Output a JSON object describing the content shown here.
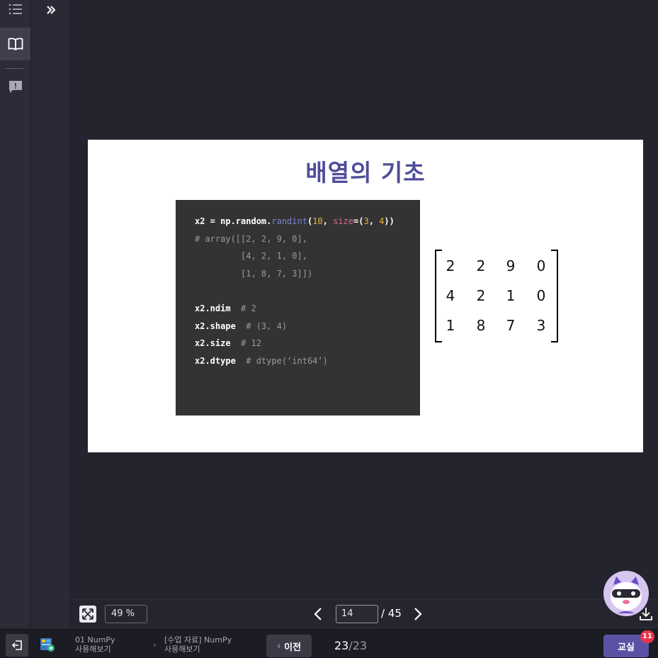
{
  "slide": {
    "title": "배열의 기초",
    "code": {
      "line1": {
        "a": "x2 = np.random.",
        "fn": "randint",
        "b": "(",
        "n1": "10",
        "c": ", ",
        "kw": "size",
        "d": "=(",
        "n2": "3",
        "e": ", ",
        "n3": "4",
        "f": "))"
      },
      "line2": "# array([[2, 2, 9, 0],",
      "line3": "         [4, 2, 1, 0],",
      "line4": "         [1, 8, 7, 3]])",
      "line6": {
        "code": "x2.ndim",
        "comment": "  # 2"
      },
      "line7": {
        "code": "x2.shape",
        "comment": "  # (3, 4)"
      },
      "line8": {
        "code": "x2.size",
        "comment": "  # 12"
      },
      "line9": {
        "code": "x2.dtype",
        "comment": "  # dtype(‘int64’)"
      }
    },
    "matrix": [
      [
        "2",
        "2",
        "9",
        "0"
      ],
      [
        "4",
        "2",
        "1",
        "0"
      ],
      [
        "1",
        "8",
        "7",
        "3"
      ]
    ]
  },
  "viewer": {
    "zoom": "49 %",
    "page_current": "14",
    "page_total": "/ 45"
  },
  "bottom": {
    "breadcrumb1_line1": "01 NumPy",
    "breadcrumb1_line2": "사용해보기",
    "breadcrumb_sep": "›",
    "breadcrumb2_line1": "[수업 자료] NumPy",
    "breadcrumb2_line2": "사용해보기",
    "prev_label": "이전",
    "prev_chevron": "‹",
    "progress_current": "23",
    "progress_total": "/23",
    "class_label": "교실",
    "notification_count": "11"
  },
  "colors": {
    "accent": "#5a53a4",
    "title": "#4f4d9a",
    "badge": "#e8344a"
  },
  "icons": [
    "list-icon",
    "book-icon",
    "feedback-icon",
    "double-chevron-right-icon",
    "fit-screen-icon",
    "chevron-left-icon",
    "chevron-right-icon",
    "download-icon",
    "exit-icon",
    "course-icon",
    "mascot-avatar"
  ]
}
